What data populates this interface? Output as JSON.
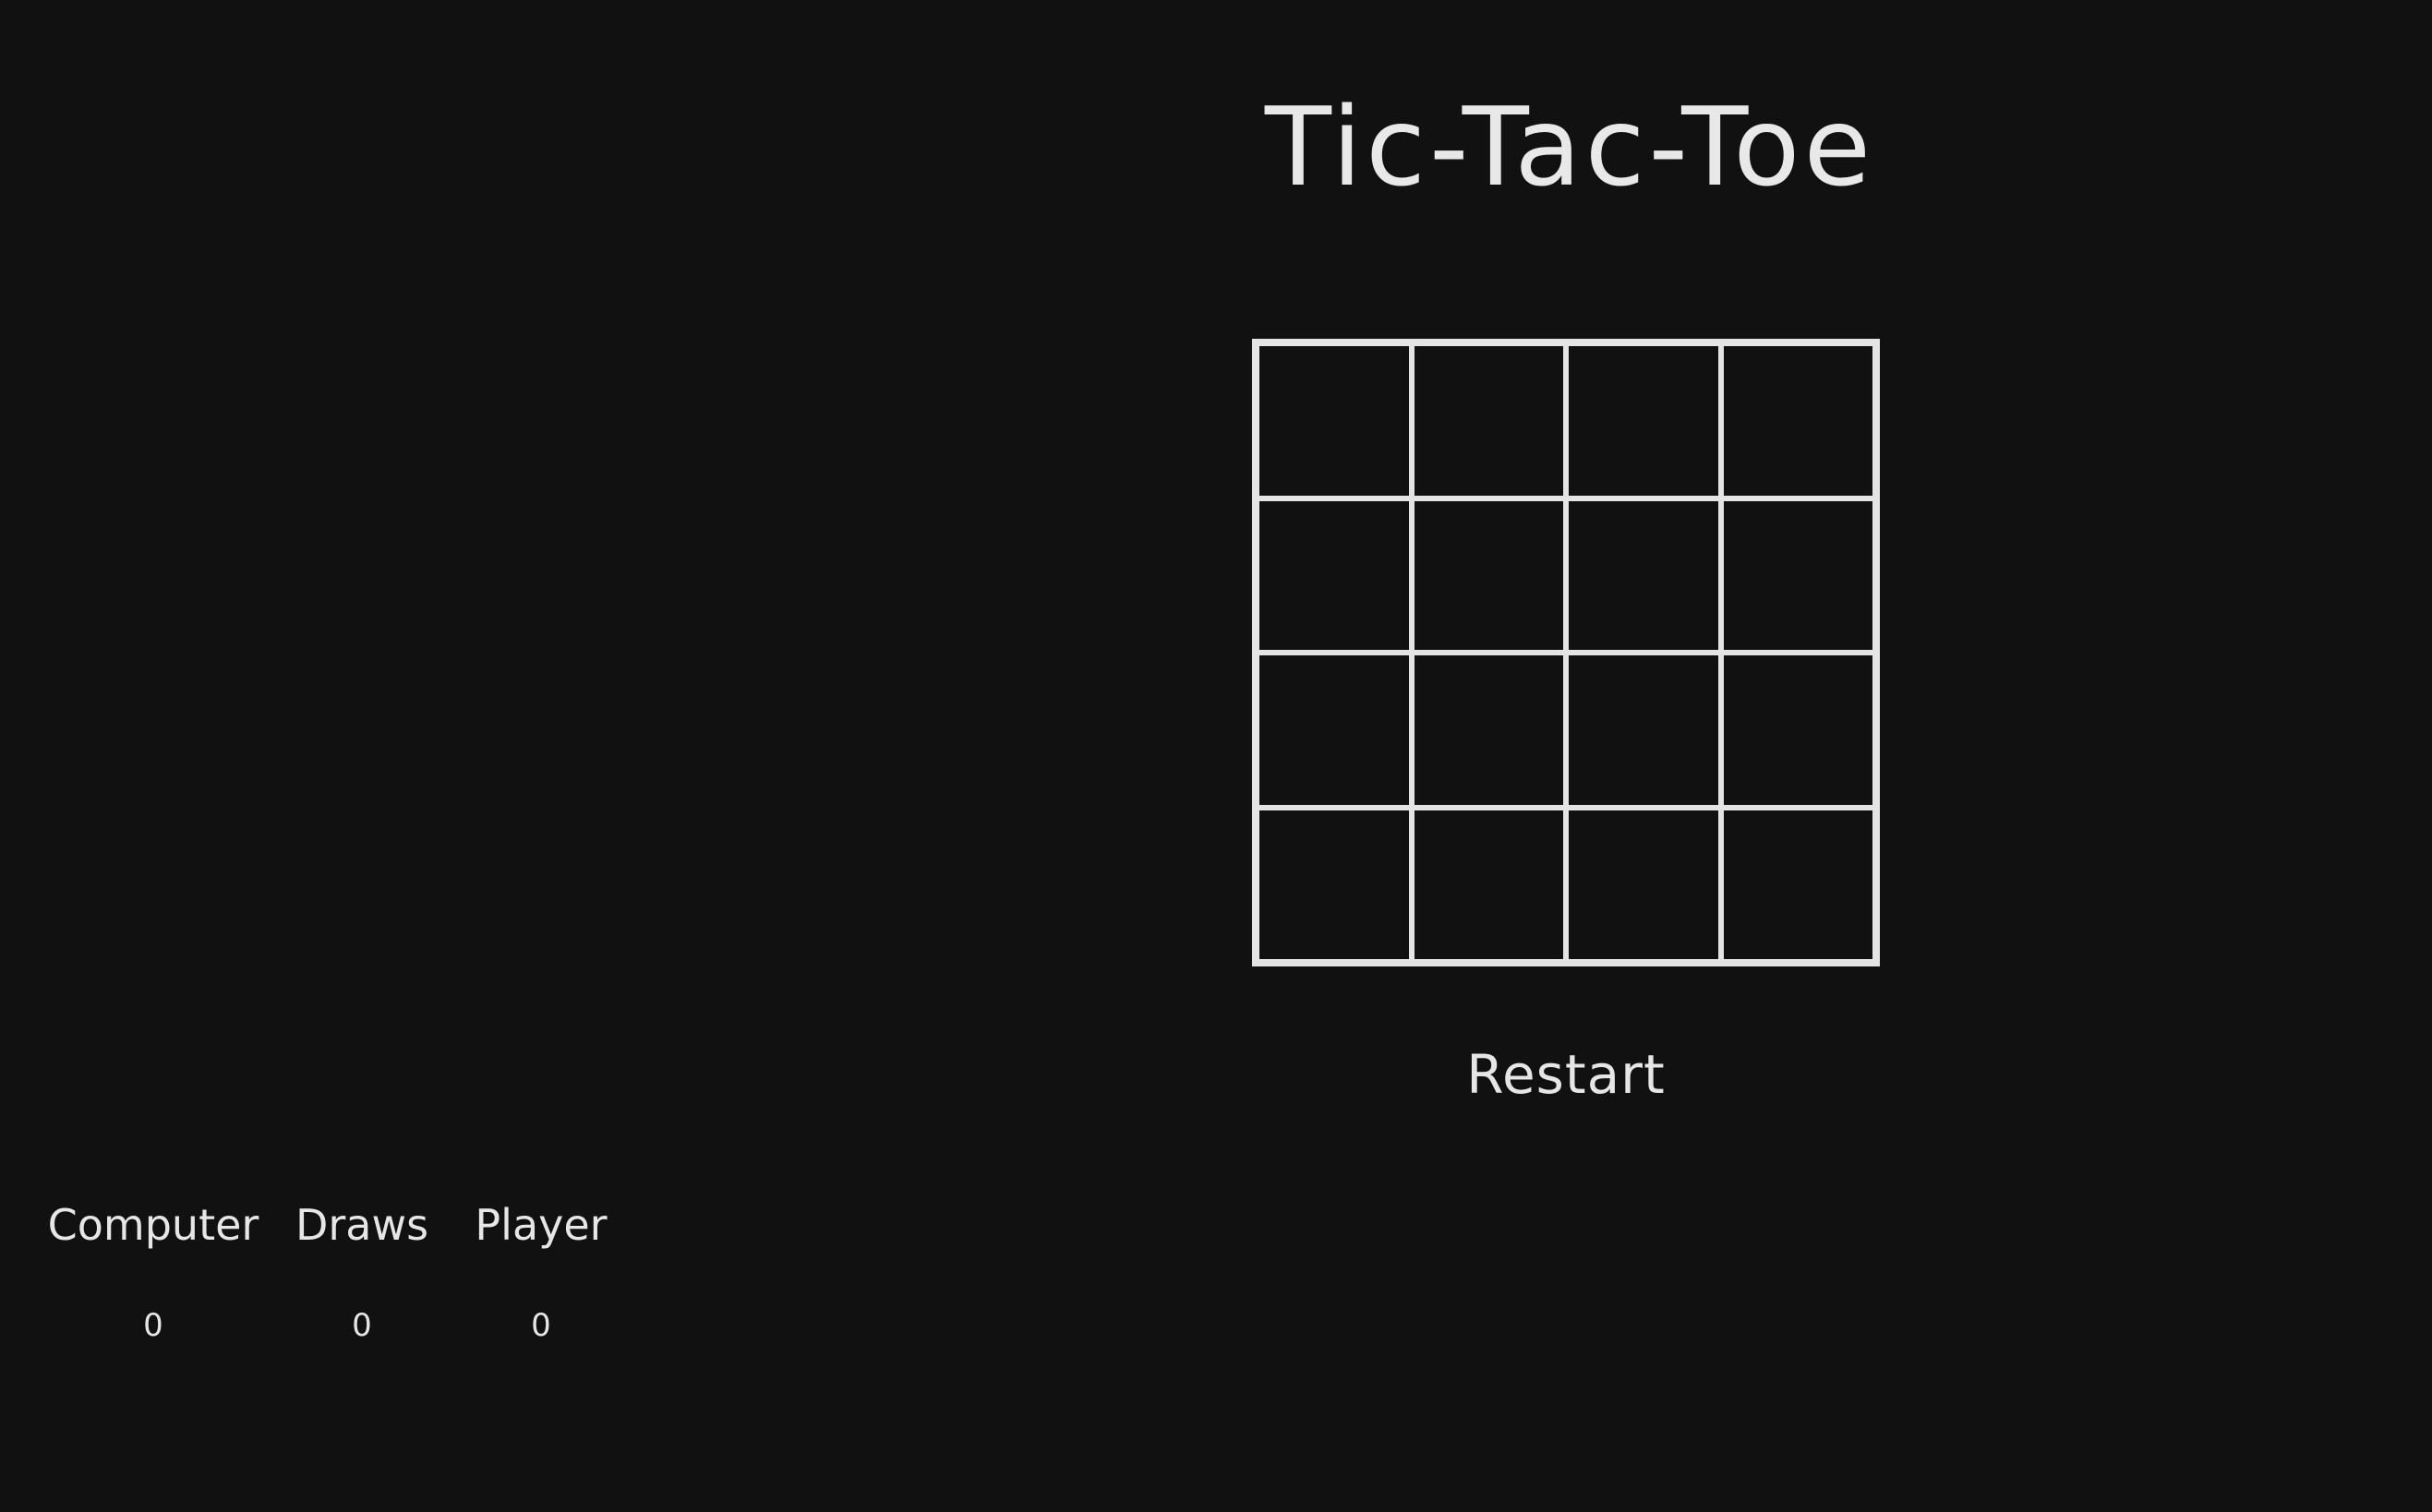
{
  "game": {
    "title": "Tic-Tac-Toe",
    "board": {
      "rows": 4,
      "cols": 4,
      "cells": [
        "",
        "",
        "",
        "",
        "",
        "",
        "",
        "",
        "",
        "",
        "",
        "",
        "",
        "",
        "",
        ""
      ]
    },
    "restart_label": "Restart"
  },
  "scoreboard": {
    "computer_label": "Computer",
    "computer_score": "0",
    "draws_label": "Draws",
    "draws_score": "0",
    "player_label": "Player",
    "player_score": "0"
  },
  "colors": {
    "background": "#111111",
    "foreground": "#e6e6e6"
  }
}
